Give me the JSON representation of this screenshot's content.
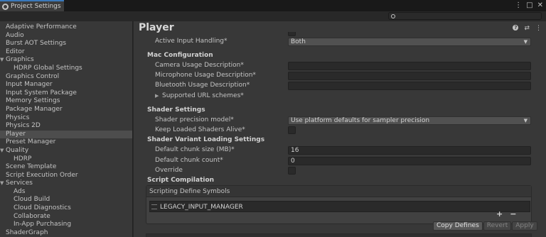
{
  "window": {
    "tab_title": "Project Settings",
    "controls": [
      "⋮",
      "□",
      "✕"
    ]
  },
  "search": {
    "placeholder": ""
  },
  "sidebar": {
    "items": [
      {
        "label": "Adaptive Performance",
        "level": 0
      },
      {
        "label": "Audio",
        "level": 0
      },
      {
        "label": "Burst AOT Settings",
        "level": 0
      },
      {
        "label": "Editor",
        "level": 0
      },
      {
        "label": "Graphics",
        "level": 0,
        "expandable": true
      },
      {
        "label": "HDRP Global Settings",
        "level": 1
      },
      {
        "label": "Graphics Control",
        "level": 0
      },
      {
        "label": "Input Manager",
        "level": 0
      },
      {
        "label": "Input System Package",
        "level": 0
      },
      {
        "label": "Memory Settings",
        "level": 0
      },
      {
        "label": "Package Manager",
        "level": 0
      },
      {
        "label": "Physics",
        "level": 0
      },
      {
        "label": "Physics 2D",
        "level": 0
      },
      {
        "label": "Player",
        "level": 0,
        "selected": true
      },
      {
        "label": "Preset Manager",
        "level": 0
      },
      {
        "label": "Quality",
        "level": 0,
        "expandable": true
      },
      {
        "label": "HDRP",
        "level": 1
      },
      {
        "label": "Scene Template",
        "level": 0
      },
      {
        "label": "Script Execution Order",
        "level": 0
      },
      {
        "label": "Services",
        "level": 0,
        "expandable": true
      },
      {
        "label": "Ads",
        "level": 1
      },
      {
        "label": "Cloud Build",
        "level": 1
      },
      {
        "label": "Cloud Diagnostics",
        "level": 1
      },
      {
        "label": "Collaborate",
        "level": 1
      },
      {
        "label": "In-App Purchasing",
        "level": 1
      },
      {
        "label": "ShaderGraph",
        "level": 0
      }
    ]
  },
  "main": {
    "title": "Player",
    "active_input_handling": {
      "label": "Active Input Handling*",
      "value": "Both"
    },
    "mac_config": {
      "heading": "Mac Configuration",
      "camera_label": "Camera Usage Description*",
      "camera_value": "",
      "microphone_label": "Microphone Usage Description*",
      "microphone_value": "",
      "bluetooth_label": "Bluetooth Usage Description*",
      "bluetooth_value": "",
      "url_schemes_label": "Supported URL schemes*"
    },
    "shader_settings": {
      "heading": "Shader Settings",
      "precision_label": "Shader precision model*",
      "precision_value": "Use platform defaults for sampler precision",
      "keep_loaded_label": "Keep Loaded Shaders Alive*",
      "keep_loaded_checked": false
    },
    "shader_variant": {
      "heading": "Shader Variant Loading Settings",
      "chunk_size_label": "Default chunk size (MB)*",
      "chunk_size_value": "16",
      "chunk_count_label": "Default chunk count*",
      "chunk_count_value": "0",
      "override_label": "Override",
      "override_checked": false
    },
    "script_compilation": {
      "heading": "Script Compilation",
      "symbols_header": "Scripting Define Symbols",
      "symbols": [
        "LEGACY_INPUT_MANAGER"
      ],
      "add": "+",
      "remove": "−",
      "copy_defines": "Copy Defines",
      "revert": "Revert",
      "apply": "Apply"
    }
  },
  "colors": {
    "accent": "#3a79bb",
    "selected": "#4d4d4d",
    "panel": "#383838"
  }
}
